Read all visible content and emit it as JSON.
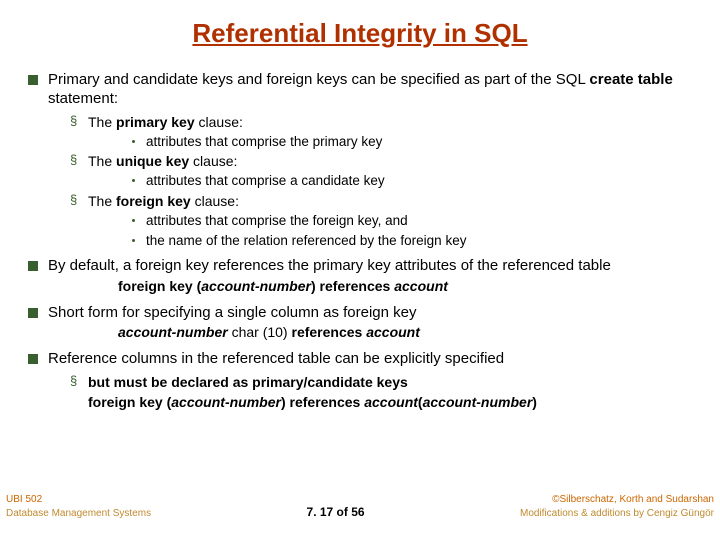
{
  "title": "Referential Integrity in SQL",
  "b1": {
    "lead": "Primary and candidate keys and foreign keys can be specified as part of the SQL ",
    "strong": "create table",
    "tail": " statement:",
    "s1": {
      "label": "The ",
      "strong": "primary key ",
      "tail": "clause:",
      "d1": "attributes that comprise the primary key"
    },
    "s2": {
      "label": "The ",
      "strong": "unique key ",
      "tail": "clause:",
      "d1": "attributes that comprise a candidate key"
    },
    "s3": {
      "label": "The ",
      "strong": "foreign key ",
      "tail": "clause:",
      "d1": "attributes that comprise the foreign key, and",
      "d2": "the name of the relation referenced by the foreign key"
    }
  },
  "b2": {
    "text": "By default, a foreign key references the primary key attributes of the referenced table",
    "kw_fk": "foreign key",
    "paren_open": " (",
    "arg": "account-number",
    "paren_close": ") ",
    "kw_ref": "references ",
    "tbl": "account"
  },
  "b3": {
    "text": "Short form for specifying a single column as foreign key",
    "col": "account-number",
    "type": " char (10) ",
    "kw_ref": "references ",
    "tbl": "account"
  },
  "b4": {
    "text": "Reference columns in the referenced table can be explicitly specified",
    "s1": "but must be declared as primary/candidate keys",
    "kw_fk": "foreign key",
    "paren_open": " (",
    "arg": "account-number",
    "paren_close": ") ",
    "kw_ref": "references ",
    "tbl": "account",
    "paren2_open": "(",
    "arg2": "account-number",
    "paren2_close": ")"
  },
  "footer": {
    "course": "UBI 502",
    "copyright": "©Silberschatz, Korth and Sudarshan",
    "dept": "Database Management Systems",
    "page": "7. 17 of 56",
    "mods": "Modifications & additions by Cengiz Güngör"
  }
}
